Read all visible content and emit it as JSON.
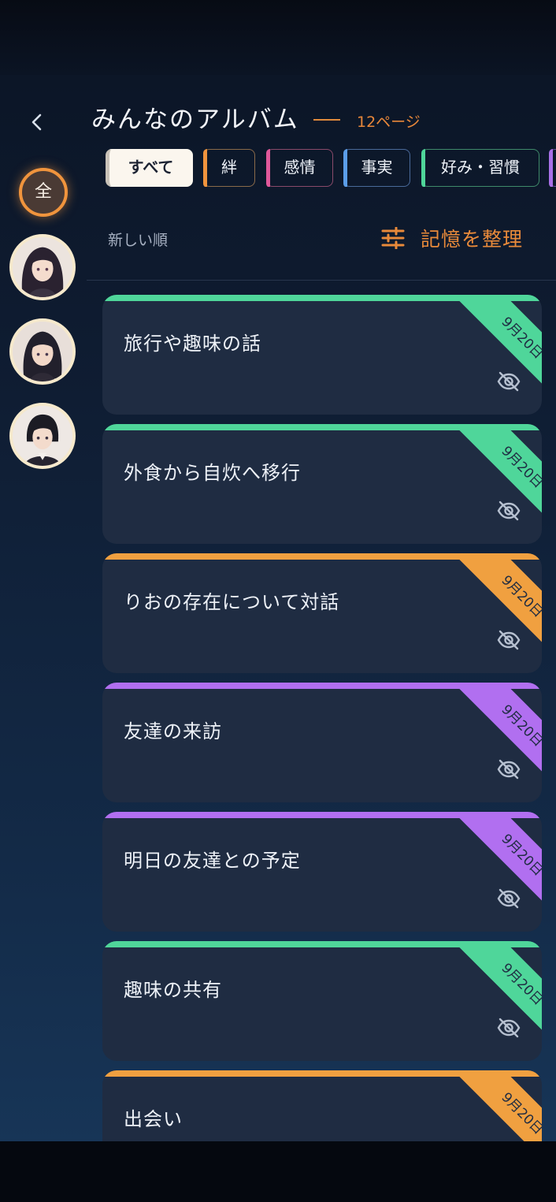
{
  "header": {
    "title": "みんなのアルバム",
    "page_count": "12ページ"
  },
  "filters": [
    {
      "label": "すべて",
      "active": true,
      "color": "#c9c2b8"
    },
    {
      "label": "絆",
      "active": false,
      "color": "#f0943d"
    },
    {
      "label": "感情",
      "active": false,
      "color": "#e0589a"
    },
    {
      "label": "事実",
      "active": false,
      "color": "#5b9de8"
    },
    {
      "label": "好み・習慣",
      "active": false,
      "color": "#4fd69a"
    },
    {
      "label": "",
      "active": false,
      "color": "#a970e8"
    }
  ],
  "sidebar": {
    "all_label": "全",
    "characters": [
      {
        "icon": "character-avatar-1"
      },
      {
        "icon": "character-avatar-2"
      },
      {
        "icon": "character-avatar-3"
      }
    ]
  },
  "sort_label": "新しい順",
  "organize_label": "記憶を整理",
  "colors": {
    "green": "#4fd69a",
    "orange": "#f0a040",
    "purple": "#b16ff0"
  },
  "cards": [
    {
      "title": "旅行や趣味の話",
      "date": "9月20日",
      "color": "green"
    },
    {
      "title": "外食から自炊へ移行",
      "date": "9月20日",
      "color": "green"
    },
    {
      "title": "りおの存在について対話",
      "date": "9月20日",
      "color": "orange"
    },
    {
      "title": "友達の来訪",
      "date": "9月20日",
      "color": "purple"
    },
    {
      "title": "明日の友達との予定",
      "date": "9月20日",
      "color": "purple"
    },
    {
      "title": "趣味の共有",
      "date": "9月20日",
      "color": "green"
    },
    {
      "title": "出会い",
      "date": "9月20日",
      "color": "orange"
    }
  ]
}
